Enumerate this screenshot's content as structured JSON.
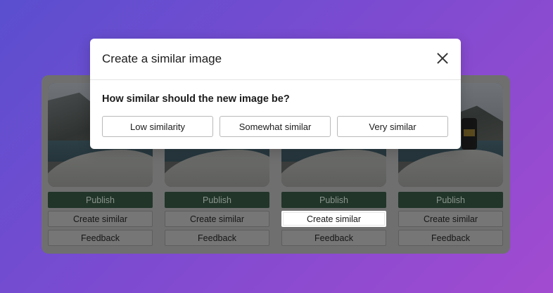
{
  "dialog": {
    "title": "Create a similar image",
    "question": "How similar should the new image be?",
    "options": [
      "Low similarity",
      "Somewhat similar",
      "Very similar"
    ]
  },
  "cards": [
    {
      "publish": "Publish",
      "create_similar": "Create similar",
      "feedback": "Feedback"
    },
    {
      "publish": "Publish",
      "create_similar": "Create similar",
      "feedback": "Feedback"
    },
    {
      "publish": "Publish",
      "create_similar": "Create similar",
      "feedback": "Feedback"
    },
    {
      "publish": "Publish",
      "create_similar": "Create similar",
      "feedback": "Feedback"
    }
  ]
}
